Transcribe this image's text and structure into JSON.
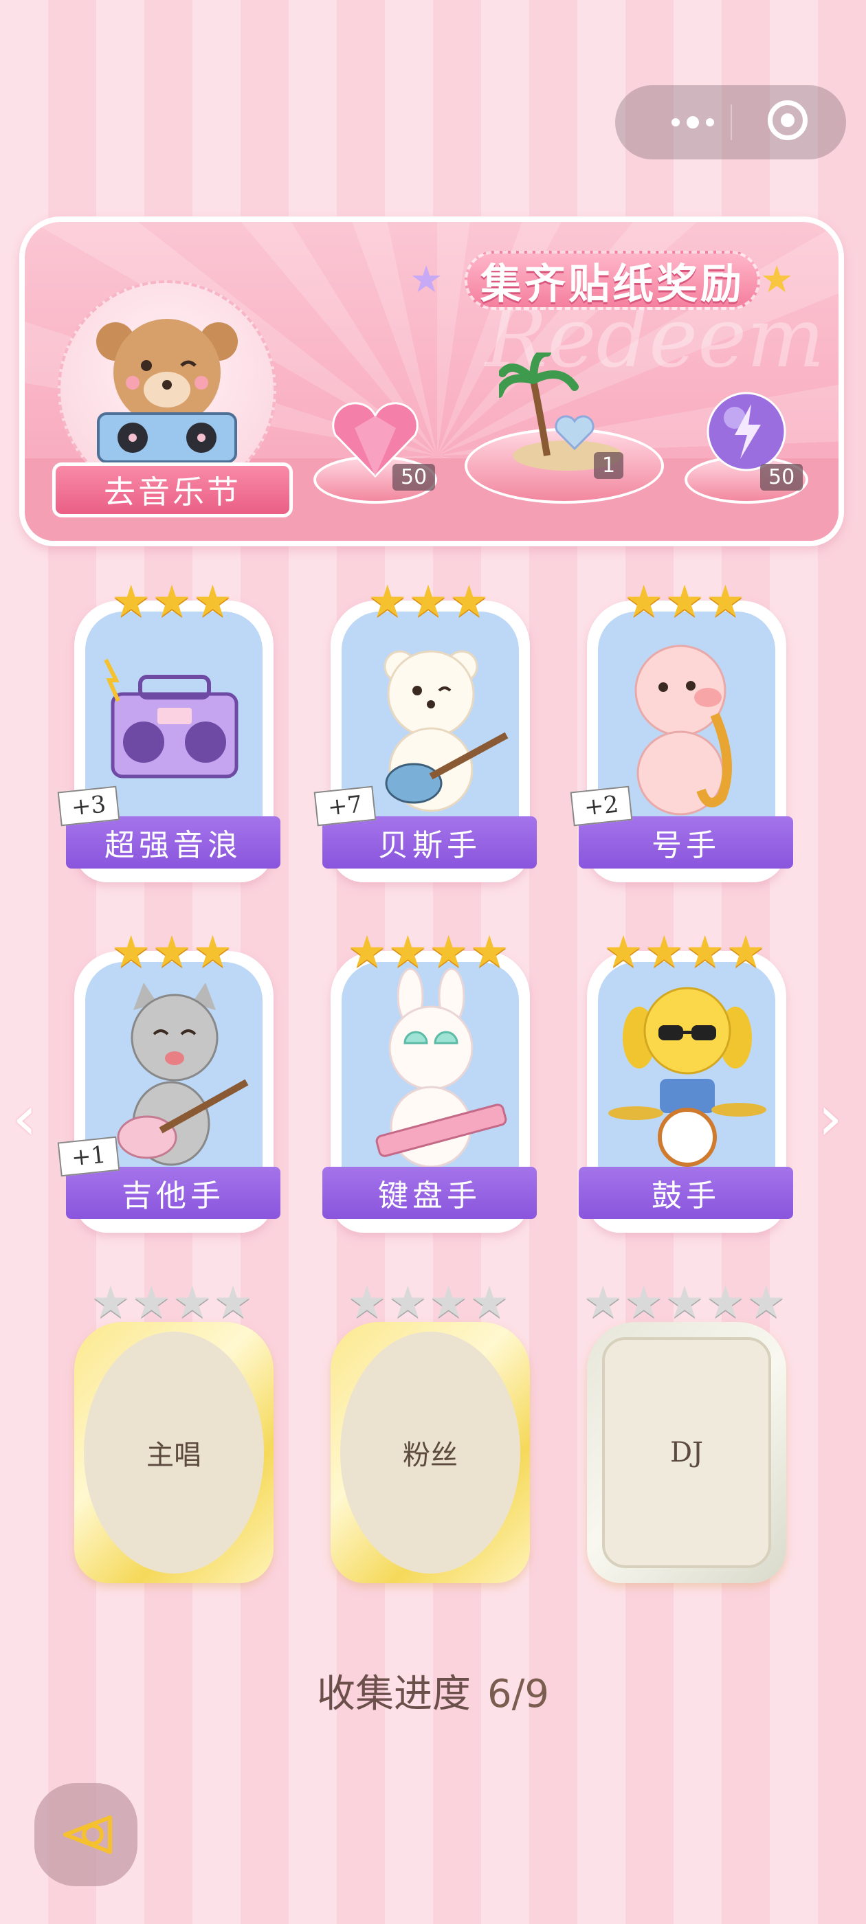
{
  "banner": {
    "title": "集齐贴纸奖励",
    "watermark": "Redeem",
    "festival_button": "去音乐节",
    "rewards": [
      {
        "icon": "heart-gem-icon",
        "count": "50"
      },
      {
        "icon": "palm-island-icon",
        "count": "1"
      },
      {
        "icon": "lightning-orb-icon",
        "count": "50"
      }
    ]
  },
  "cards": [
    {
      "name": "超强音浪",
      "stars": 3,
      "plus": "+3",
      "icon": "boombox-icon"
    },
    {
      "name": "贝斯手",
      "stars": 3,
      "plus": "+7",
      "icon": "bear-guitar-icon"
    },
    {
      "name": "号手",
      "stars": 3,
      "plus": "+2",
      "icon": "pig-saxophone-icon"
    },
    {
      "name": "吉他手",
      "stars": 3,
      "plus": "+1",
      "icon": "cat-guitar-icon"
    },
    {
      "name": "键盘手",
      "stars": 4,
      "plus": "",
      "icon": "bunny-keytar-icon"
    },
    {
      "name": "鼓手",
      "stars": 4,
      "plus": "",
      "icon": "dog-drums-icon"
    }
  ],
  "locked_cards": [
    {
      "name": "主唱",
      "stars": 4
    },
    {
      "name": "粉丝",
      "stars": 4
    },
    {
      "name": "DJ",
      "stars": 5
    }
  ],
  "progress": {
    "label": "收集进度",
    "value": "6/9"
  },
  "colors": {
    "accent": "#8a55dd",
    "pink": "#f47f9e",
    "gold": "#f6c12f"
  }
}
